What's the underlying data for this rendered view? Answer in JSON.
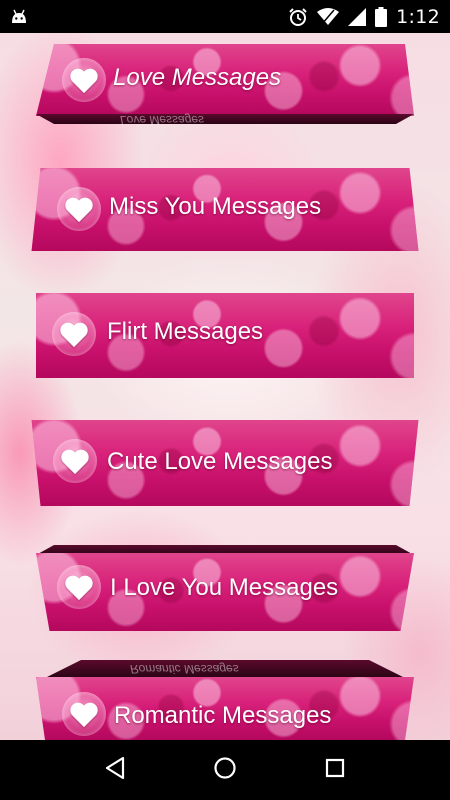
{
  "status_bar": {
    "time": "1:12",
    "icons": [
      "android-debug-icon",
      "alarm-icon",
      "wifi-icon",
      "signal-icon",
      "battery-icon"
    ]
  },
  "menu": {
    "items": [
      {
        "label": "Love Messages",
        "reflection": "Love Messages",
        "icon": "heart-icon"
      },
      {
        "label": "Miss You Messages",
        "icon": "heart-icon"
      },
      {
        "label": "Flirt Messages",
        "icon": "heart-icon"
      },
      {
        "label": "Cute Love Messages",
        "icon": "heart-icon"
      },
      {
        "label": "I Love You Messages",
        "icon": "heart-icon"
      },
      {
        "label": "Romantic Messages",
        "reflection": "Romantic Messages",
        "icon": "heart-icon"
      }
    ]
  },
  "nav_bar": {
    "buttons": [
      "back-icon",
      "home-icon",
      "recents-icon"
    ]
  },
  "colors": {
    "button_pink": "#d8217a",
    "button_dark_edge": "#2a0415",
    "label_text": "#ffffff",
    "bars": "#000000"
  }
}
